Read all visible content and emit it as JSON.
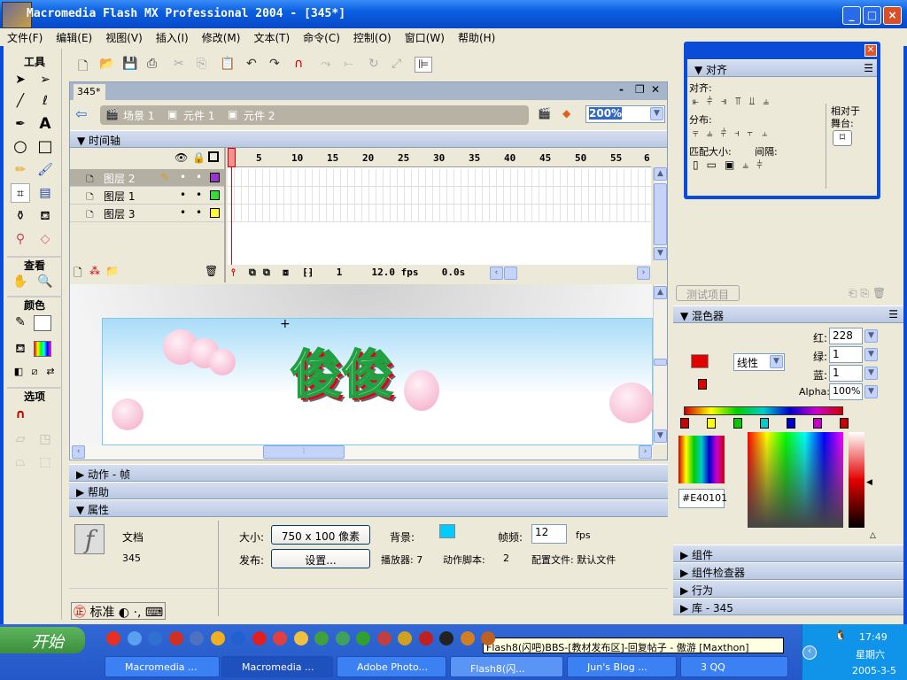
{
  "window": {
    "title": "Macromedia Flash MX Professional 2004 - [345*]"
  },
  "menu": [
    "文件(F)",
    "编辑(E)",
    "视图(V)",
    "插入(I)",
    "修改(M)",
    "文本(T)",
    "命令(C)",
    "控制(O)",
    "窗口(W)",
    "帮助(H)"
  ],
  "toolbox": {
    "tools_label": "工具",
    "view_label": "查看",
    "colors_label": "颜色",
    "options_label": "选项"
  },
  "document": {
    "tab": "345*",
    "breadcrumbs": [
      "场景 1",
      "元件 1",
      "元件 2"
    ],
    "zoom": "200%"
  },
  "timeline": {
    "title": "时间轴",
    "layers": [
      {
        "name": "图层 2",
        "color": "#9933CC",
        "active": true
      },
      {
        "name": "图层 1",
        "color": "#33DD33"
      },
      {
        "name": "图层 3",
        "color": "#FFFF33"
      }
    ],
    "ruler": [
      "1",
      "5",
      "10",
      "15",
      "20",
      "25",
      "30",
      "35",
      "40",
      "45",
      "50",
      "55",
      "6"
    ],
    "current_frame": "1",
    "fps": "12.0 fps",
    "time": "0.0s"
  },
  "stage": {
    "text": "俊俊"
  },
  "panels": {
    "actions": "动作 - 帧",
    "help": "帮助",
    "properties": "属性"
  },
  "properties": {
    "type": "文档",
    "name": "345",
    "size_label": "大小:",
    "size": "750 x 100 像素",
    "bg_label": "背景:",
    "bg_color": "#00CCFF",
    "fps_label": "帧频:",
    "fps": "12",
    "fps_unit": "fps",
    "publish_label": "发布:",
    "settings": "设置...",
    "player": "播放器: 7",
    "actionscript_label": "动作脚本:",
    "actionscript": "2",
    "profile": "配置文件: 默认文件"
  },
  "ime": {
    "mode": "标准"
  },
  "align": {
    "title": "对齐",
    "align_label": "对齐:",
    "distribute_label": "分布:",
    "match_label": "匹配大小:",
    "space_label": "间隔:",
    "relative_label": "相对于",
    "stage_label": "舞台:"
  },
  "project": {
    "test_button": "测试项目"
  },
  "mixer": {
    "title": "混色器",
    "fill_type": "线性",
    "red_label": "红:",
    "red": "228",
    "green_label": "绿:",
    "green": "1",
    "blue_label": "蓝:",
    "blue": "1",
    "alpha_label": "Alpha:",
    "alpha": "100%",
    "hex": "#E40101",
    "gradient_stops": [
      "#CC0000",
      "#FFFF00",
      "#00CC00",
      "#00CCCC",
      "#0000CC",
      "#CC00CC",
      "#CC0000"
    ]
  },
  "collapsed_panels": [
    "组件",
    "组件检查器",
    "行为",
    "库 - 345"
  ],
  "taskbar": {
    "start": "开始",
    "tooltip": "Flash8(闪吧)BBS-[教材发布区]-回复帖子 - 傲游 [Maxthon]",
    "tasks": [
      "Macromedia ...",
      "Macromedia ...",
      "Adobe Photo...",
      "Flash8(闪...",
      "Jun's Blog ...",
      "3 QQ"
    ],
    "clock": "17:49",
    "weekday": "星期六",
    "date": "2005-3-5"
  }
}
